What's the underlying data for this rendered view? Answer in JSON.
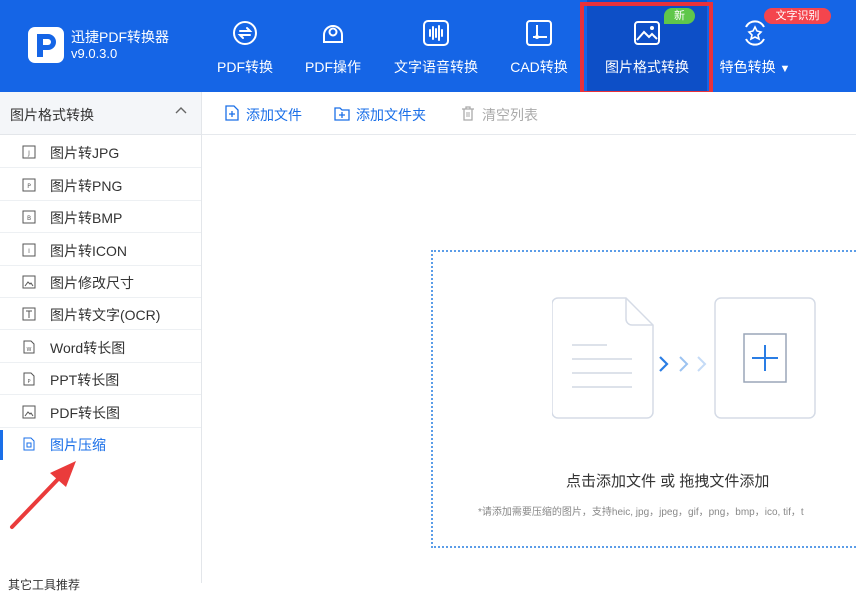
{
  "app": {
    "name": "迅捷PDF转换器",
    "version": "v9.0.3.0"
  },
  "nav": [
    {
      "id": "pdf-convert",
      "label": "PDF转换",
      "icon": "pdf-convert-icon"
    },
    {
      "id": "pdf-ops",
      "label": "PDF操作",
      "icon": "pdf-settings-icon"
    },
    {
      "id": "text-voice",
      "label": "文字语音转换",
      "icon": "audio-wave-icon"
    },
    {
      "id": "cad",
      "label": "CAD转换",
      "icon": "cad-icon"
    },
    {
      "id": "image-format",
      "label": "图片格式转换",
      "icon": "image-icon",
      "active": true
    },
    {
      "id": "special",
      "label": "特色转换",
      "icon": "sparkle-icon"
    }
  ],
  "badges": {
    "new": "新",
    "ocr": "文字识别"
  },
  "sidebar": {
    "title": "图片格式转换",
    "items": [
      {
        "label": "图片转JPG",
        "icon": "jpg-file-icon"
      },
      {
        "label": "图片转PNG",
        "icon": "png-file-icon"
      },
      {
        "label": "图片转BMP",
        "icon": "bmp-file-icon"
      },
      {
        "label": "图片转ICON",
        "icon": "icon-file-icon"
      },
      {
        "label": "图片修改尺寸",
        "icon": "resize-image-icon"
      },
      {
        "label": "图片转文字(OCR)",
        "icon": "text-icon"
      },
      {
        "label": "Word转长图",
        "icon": "word-file-icon"
      },
      {
        "label": "PPT转长图",
        "icon": "ppt-file-icon"
      },
      {
        "label": "PDF转长图",
        "icon": "pdf-image-icon"
      },
      {
        "label": "图片压缩",
        "icon": "compress-icon",
        "active": true
      }
    ],
    "bottom_label": "其它工具推荐"
  },
  "toolbar": {
    "add_file": "添加文件",
    "add_folder": "添加文件夹",
    "clear_list": "清空列表"
  },
  "dropzone": {
    "main_text": "点击添加文件 或 拖拽文件添加",
    "sub_text": "*请添加需要压缩的图片，支持heic, jpg，jpeg，gif，png，bmp，ico, tif，t"
  },
  "colors": {
    "header": "#1565e6",
    "active_nav": "#0d4fc7",
    "accent": "#1a6fe8",
    "highlight": "#e8313b",
    "new_badge": "#5fc74b",
    "ocr_badge": "#f4454d"
  }
}
